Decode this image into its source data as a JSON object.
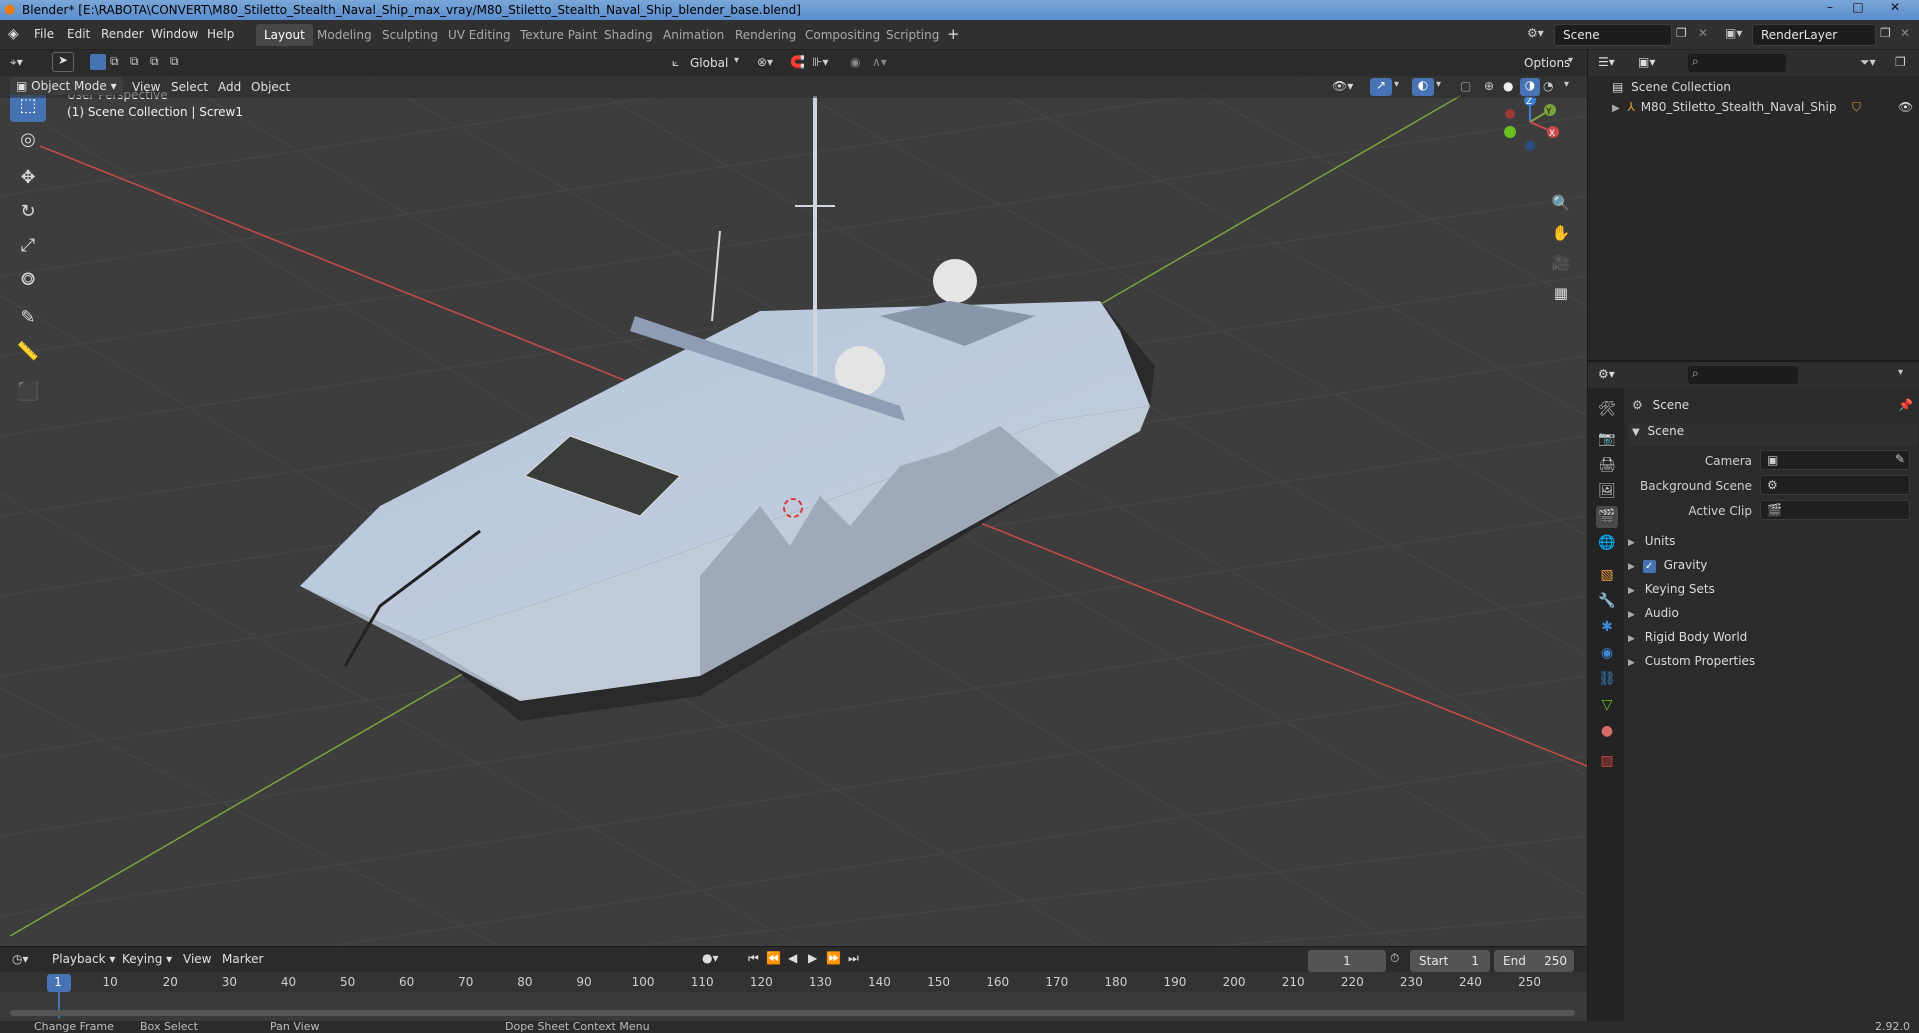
{
  "window": {
    "title": "Blender* [E:\\RABOTA\\CONVERT\\M80_Stiletto_Stealth_Naval_Ship_max_vray/M80_Stiletto_Stealth_Naval_Ship_blender_base.blend]",
    "controls": [
      "–",
      "□",
      "✕"
    ]
  },
  "menu": [
    "File",
    "Edit",
    "Render",
    "Window",
    "Help"
  ],
  "workspaces": [
    {
      "label": "Layout",
      "active": true
    },
    {
      "label": "Modeling"
    },
    {
      "label": "Sculpting"
    },
    {
      "label": "UV Editing"
    },
    {
      "label": "Texture Paint"
    },
    {
      "label": "Shading"
    },
    {
      "label": "Animation"
    },
    {
      "label": "Rendering"
    },
    {
      "label": "Compositing"
    },
    {
      "label": "Scripting"
    }
  ],
  "add_workspace": "+",
  "scene_field": "Scene",
  "renderlayer_field": "RenderLayer",
  "viewport_header": {
    "mode": "Object Mode",
    "menus": [
      "View",
      "Select",
      "Add",
      "Object"
    ],
    "transform_orientation": "Global",
    "options": "Options"
  },
  "viewport": {
    "perspective": "User Perspective",
    "collection_info": "(1) Scene Collection | Screw1",
    "gizmo_axes": {
      "x": "X",
      "y": "Y",
      "z": "Z"
    }
  },
  "tools": [
    {
      "name": "select-box-tool",
      "icon": "⬚",
      "active": true
    },
    {
      "name": "cursor-tool",
      "icon": "◎"
    },
    {
      "name": "move-tool",
      "icon": "✥"
    },
    {
      "name": "rotate-tool",
      "icon": "↻"
    },
    {
      "name": "scale-tool",
      "icon": "⤢"
    },
    {
      "name": "transform-tool",
      "icon": "⭗"
    },
    {
      "name": "annotate-tool",
      "icon": "✎"
    },
    {
      "name": "measure-tool",
      "icon": "📏"
    },
    {
      "name": "add-cube-tool",
      "icon": "⬛"
    }
  ],
  "nav_gizmos": [
    "🔍",
    "✋",
    "🎥",
    "▦"
  ],
  "outliner": {
    "root": "Scene Collection",
    "items": [
      {
        "label": "M80_Stiletto_Stealth_Naval_Ship"
      }
    ]
  },
  "properties": {
    "context": "Scene",
    "panel": "Scene",
    "fields": [
      {
        "label": "Camera",
        "value": ""
      },
      {
        "label": "Background Scene",
        "value": ""
      },
      {
        "label": "Active Clip",
        "value": ""
      }
    ],
    "sections": [
      {
        "label": "Units"
      },
      {
        "label": "Gravity",
        "checkbox": true
      },
      {
        "label": "Keying Sets"
      },
      {
        "label": "Audio"
      },
      {
        "label": "Rigid Body World"
      },
      {
        "label": "Custom Properties"
      }
    ],
    "tab_icons": [
      "🛠",
      "📷",
      "🖨",
      "🖼",
      "🎬",
      "🌐",
      "▧",
      "🔧",
      "✱",
      "◉",
      "⛓",
      "▽",
      "●",
      "▨"
    ]
  },
  "timeline": {
    "menus": [
      "Playback",
      "Keying",
      "View",
      "Marker"
    ],
    "current_frame": "1",
    "start_label": "Start",
    "start": "1",
    "end_label": "End",
    "end": "250",
    "ticks": [
      "1",
      "10",
      "20",
      "30",
      "40",
      "50",
      "60",
      "70",
      "80",
      "90",
      "100",
      "110",
      "120",
      "130",
      "140",
      "150",
      "160",
      "170",
      "180",
      "190",
      "200",
      "210",
      "220",
      "230",
      "240",
      "250"
    ]
  },
  "statusbar": {
    "items": [
      "Change Frame",
      "Box Select",
      "Pan View",
      "Dope Sheet Context Menu"
    ],
    "version": "2.92.0"
  },
  "colors": {
    "accent": "#4772b3",
    "axis_x": "#c84a4a",
    "axis_y": "#7ea33a",
    "axis_z": "#3b7fd4",
    "ship_hull": "#b8c4d6"
  }
}
